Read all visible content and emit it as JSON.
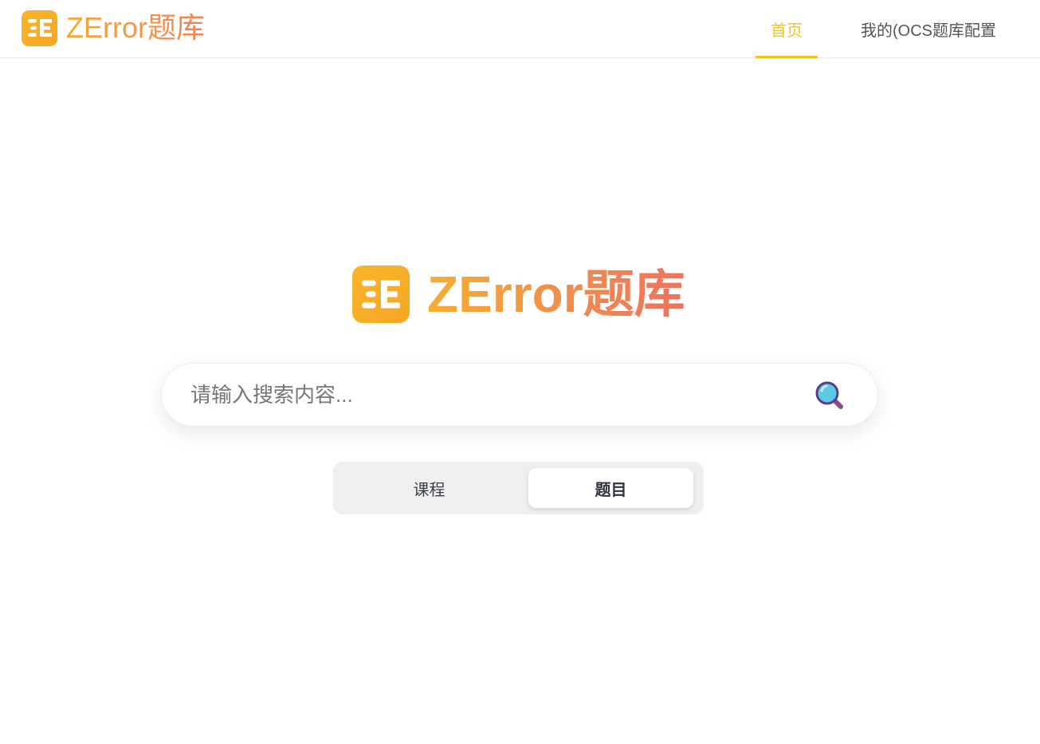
{
  "header": {
    "brand_name": "ZError题库",
    "nav": [
      {
        "label": "首页",
        "active": true
      },
      {
        "label": "我的(OCS题库配置",
        "active": false
      }
    ]
  },
  "hero": {
    "brand_name": "ZError题库"
  },
  "search": {
    "placeholder": "请输入搜索内容...",
    "value": "",
    "button_icon": "magnifying-glass-icon"
  },
  "mode_switch": {
    "options": [
      {
        "label": "课程",
        "selected": false
      },
      {
        "label": "题目",
        "selected": true
      }
    ]
  },
  "colors": {
    "accent": "#f4c21f",
    "logo_bg": "#f9b52c",
    "brand_gradient_start": "#f7a937",
    "brand_gradient_end": "#f08258"
  }
}
